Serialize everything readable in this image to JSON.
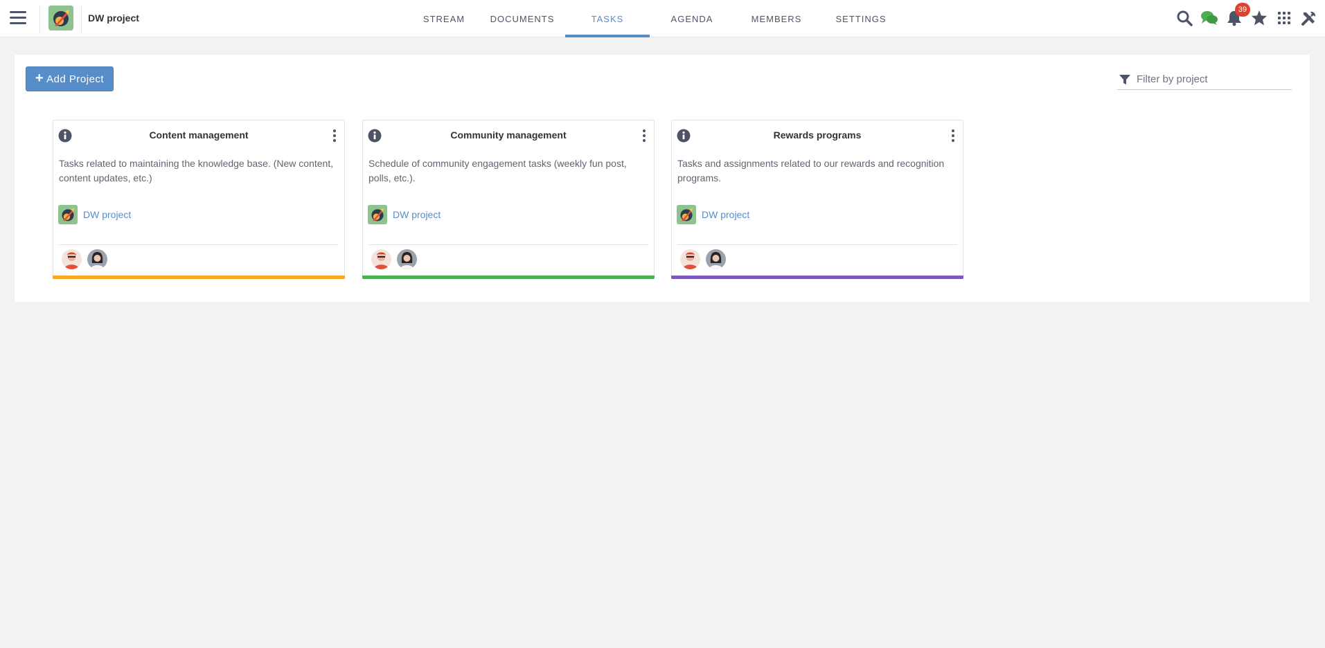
{
  "header": {
    "space_name": "DW project",
    "tabs": [
      {
        "label": "STREAM"
      },
      {
        "label": "DOCUMENTS"
      },
      {
        "label": "TASKS"
      },
      {
        "label": "AGENDA"
      },
      {
        "label": "MEMBERS"
      },
      {
        "label": "SETTINGS"
      }
    ],
    "active_tab": "TASKS",
    "notification_count": "39",
    "icons": [
      "search-icon",
      "chat-icon",
      "bell-icon",
      "star-icon",
      "apps-grid-icon",
      "tools-icon"
    ]
  },
  "toolbar": {
    "add_project_label": "Add Project",
    "filter_placeholder": "Filter by project"
  },
  "projects": [
    {
      "title": "Content management",
      "description": "Tasks related to maintaining the knowledge base. (New content, content updates, etc.)",
      "space": "DW project",
      "color": "#f9a825"
    },
    {
      "title": "Community management",
      "description": "Schedule of community engagement tasks (weekly fun post, polls, etc.).",
      "space": "DW project",
      "color": "#4caf50"
    },
    {
      "title": "Rewards programs",
      "description": "Tasks and assignments related to our rewards and recognition programs.",
      "space": "DW project",
      "color": "#7e57c2"
    }
  ],
  "colors": {
    "accent": "#578dc9",
    "badge": "#e0412e",
    "chat": "#4caf50"
  }
}
